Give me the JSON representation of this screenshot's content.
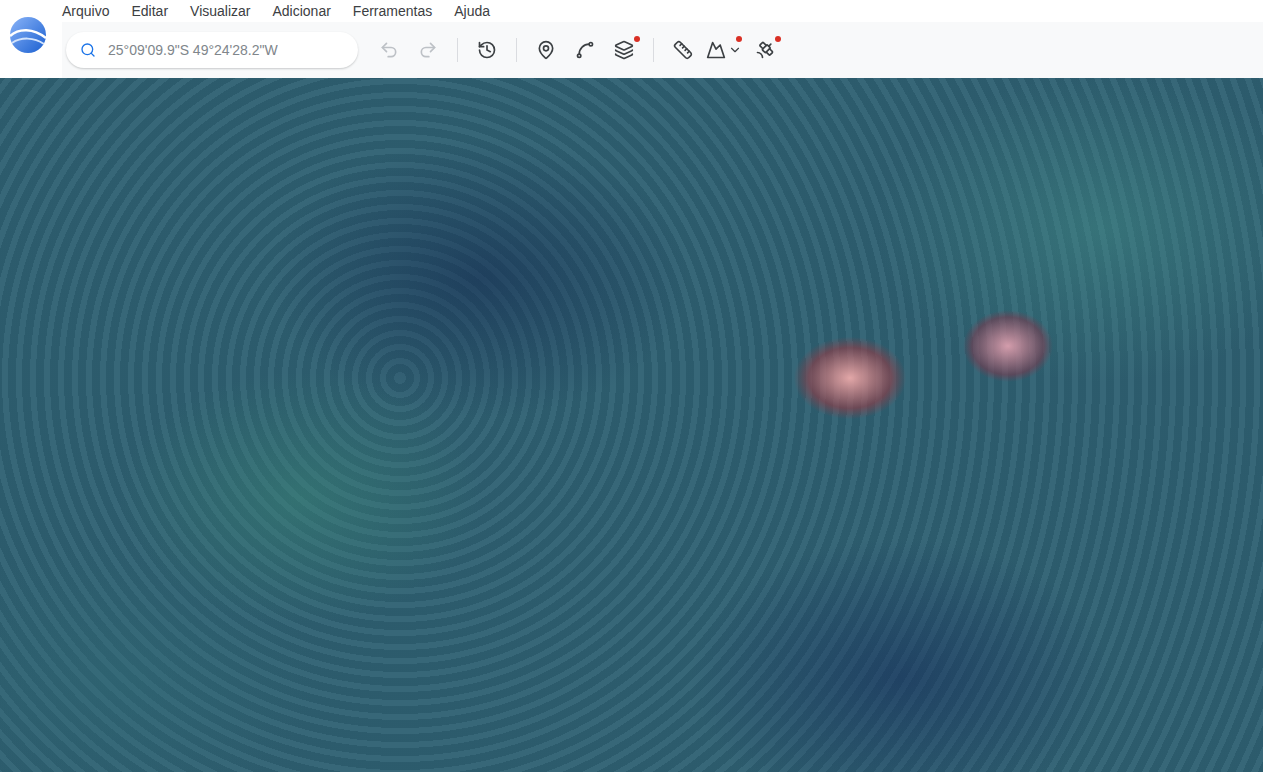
{
  "menu": [
    {
      "label": "Arquivo"
    },
    {
      "label": "Editar"
    },
    {
      "label": "Visualizar"
    },
    {
      "label": "Adicionar"
    },
    {
      "label": "Ferramentas"
    },
    {
      "label": "Ajuda"
    }
  ],
  "search": {
    "value": "25°09'09.9\"S 49°24'28.2\"W"
  },
  "toolbar": [
    {
      "kind": "undo",
      "disabled": true,
      "badge": false,
      "dropdown": false
    },
    {
      "kind": "redo",
      "disabled": true,
      "badge": false,
      "dropdown": false
    },
    {
      "kind": "separator",
      "disabled": false,
      "badge": false,
      "dropdown": false
    },
    {
      "kind": "history",
      "disabled": false,
      "badge": false,
      "dropdown": false
    },
    {
      "kind": "separator",
      "disabled": false,
      "badge": false,
      "dropdown": false
    },
    {
      "kind": "placemark",
      "disabled": false,
      "badge": false,
      "dropdown": false
    },
    {
      "kind": "path",
      "disabled": false,
      "badge": false,
      "dropdown": false
    },
    {
      "kind": "layers",
      "disabled": false,
      "badge": true,
      "dropdown": false
    },
    {
      "kind": "separator",
      "disabled": false,
      "badge": false,
      "dropdown": false
    },
    {
      "kind": "ruler",
      "disabled": false,
      "badge": false,
      "dropdown": false
    },
    {
      "kind": "elevation",
      "disabled": false,
      "badge": true,
      "dropdown": true
    },
    {
      "kind": "tools",
      "disabled": false,
      "badge": true,
      "dropdown": false
    }
  ]
}
